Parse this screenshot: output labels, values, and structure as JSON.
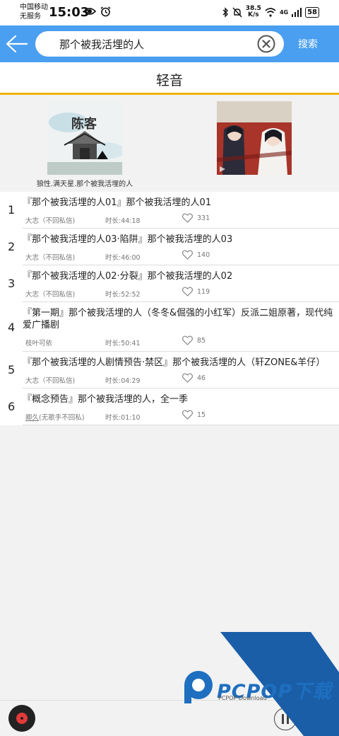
{
  "status_bar": {
    "carrier_line1": "中国移动",
    "carrier_line2": "无服务",
    "time": "15:03",
    "net_speed_value": "38.5",
    "net_speed_unit": "K/s",
    "signal_label": "4G",
    "battery": "58"
  },
  "search": {
    "query": "那个被我活埋的人",
    "submit_label": "搜索"
  },
  "section_title": "轻音",
  "albums": [
    {
      "cover_text": "陈客",
      "caption": "狼性.满天星.那个被我活埋的人"
    },
    {
      "cover_text": "",
      "caption": ""
    }
  ],
  "tracks": [
    {
      "index": "1",
      "title": "『那个被我活埋的人01』那个被我活埋的人01",
      "author": "大志（不回私信)",
      "duration": "时长:44:18",
      "likes": "331"
    },
    {
      "index": "2",
      "title": "『那个被我活埋的人03·陷阱』那个被我活埋的人03",
      "author": "大志（不回私信)",
      "duration": "时长:46:00",
      "likes": "140"
    },
    {
      "index": "3",
      "title": "『那个被我活埋的人02·分裂』那个被我活埋的人02",
      "author": "大志（不回私信)",
      "duration": "时长:52:52",
      "likes": "119"
    },
    {
      "index": "4",
      "title": "『第一期』那个被我活埋的人（冬冬&倔强的小红军）反派二姐原著，现代纯爱广播剧",
      "author": "枝叶可依",
      "duration": "时长:50:41",
      "likes": "85"
    },
    {
      "index": "5",
      "title": "『那个被我活埋的人剧情预告·禁区』那个被我活埋的人（轩ZONE&羊仔）",
      "author": "大志（不回私信)",
      "duration": "时长:04:29",
      "likes": "46"
    },
    {
      "index": "6",
      "title": "『概念预告』那个被我活埋的人，全一季",
      "author_name": "卿久",
      "author_suffix": "(无歌手不回私)",
      "duration": "时长:01:10",
      "likes": "15"
    }
  ],
  "watermark": {
    "brand": "PCPOP下载",
    "sub": "PCPOP Download"
  },
  "colors": {
    "header_blue": "#4a9ff0",
    "title_underline": "#f0b400",
    "watermark_blue": "#1e6fbf"
  }
}
